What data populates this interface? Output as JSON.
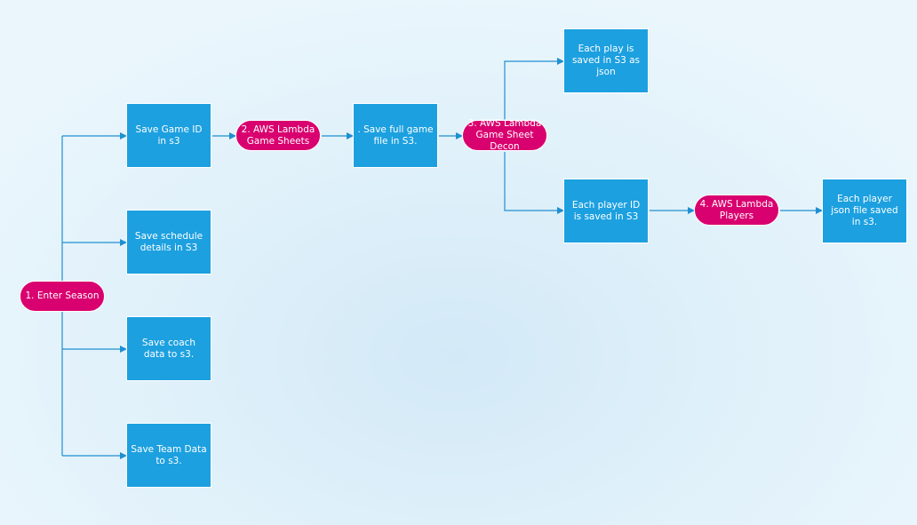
{
  "diagram": {
    "nodes": {
      "enter_season": "1.  Enter Season",
      "save_game_id": "Save Game ID  in s3",
      "save_schedule": "Save schedule details in S3",
      "save_coach": "Save coach data to s3.",
      "save_team": "Save Team Data to s3.",
      "lambda_game_sheets": "2.  AWS Lambda Game Sheets",
      "save_full_game": ".  Save full game file in S3.",
      "lambda_decon": "3.  AWS Lambda Game Sheet Decon",
      "each_play": "Each play is saved in S3 as json",
      "each_player_id": "Each player ID is saved in S3",
      "lambda_players": "4. AWS Lambda Players",
      "each_player_json": "Each player json file saved in s3."
    },
    "colors": {
      "process_box": "#1ca0e0",
      "lambda_pill": "#d9006f",
      "connector": "#1f8fd1"
    }
  }
}
